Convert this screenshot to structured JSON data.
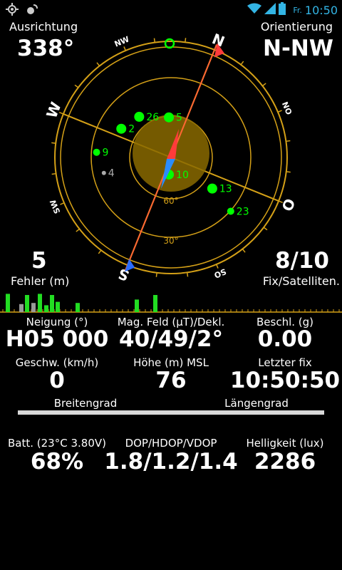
{
  "status_bar": {
    "icons_left": [
      "gps-icon",
      "settings-icon"
    ],
    "icons_right": [
      "wifi-icon",
      "signal-icon",
      "battery-icon"
    ],
    "day": "Fr.",
    "time": "10:50",
    "accent_color": "#33b5e5"
  },
  "compass": {
    "azimuth_label": "Ausrichtung",
    "azimuth_value": "338°",
    "orientation_label": "Orientierung",
    "orientation_value": "N-NW",
    "heading_deg": 338,
    "directions": {
      "N": "N",
      "NO": "NO",
      "O": "O",
      "SO": "SO",
      "S": "S",
      "SW": "SW",
      "W": "W",
      "NW": "NW"
    },
    "elevation_labels": [
      "60°",
      "30°"
    ],
    "ring_color": "#d4a017",
    "satellites": [
      {
        "id": "26",
        "azimuth": 300,
        "elevation": 45,
        "color": "#00ff00"
      },
      {
        "id": "5",
        "azimuth": 335,
        "elevation": 55,
        "color": "#00ff00"
      },
      {
        "id": "2",
        "azimuth": 278,
        "elevation": 40,
        "color": "#00ff00"
      },
      {
        "id": "9",
        "azimuth": 252,
        "elevation": 25,
        "color": "#00ff00"
      },
      {
        "id": "4",
        "azimuth": 235,
        "elevation": 30,
        "color": "#aaaaaa"
      },
      {
        "id": "10",
        "azimuth": 165,
        "elevation": 75,
        "color": "#00ff00"
      },
      {
        "id": "13",
        "azimuth": 105,
        "elevation": 45,
        "color": "#00ff00"
      },
      {
        "id": "23",
        "azimuth": 110,
        "elevation": 20,
        "color": "#00ff00"
      }
    ]
  },
  "left_stat": {
    "value": "5",
    "label": "Fehler (m)"
  },
  "right_stat": {
    "value": "8/10",
    "label": "Fix/Satelliten."
  },
  "signal_bars": [
    {
      "level": 0.8,
      "used": true
    },
    {
      "level": 0.35,
      "used": false
    },
    {
      "level": 0.75,
      "used": true
    },
    {
      "level": 0.4,
      "used": false
    },
    {
      "level": 0.8,
      "used": true
    },
    {
      "level": 0.3,
      "used": true
    },
    {
      "level": 0.75,
      "used": true
    },
    {
      "level": 0.45,
      "used": true
    },
    {
      "level": 0.4,
      "used": true
    },
    {
      "level": 0.55,
      "used": true
    },
    {
      "level": 0.75,
      "used": true
    }
  ],
  "grid": {
    "neigung": {
      "label": "Neigung (°)",
      "value": "H05 000"
    },
    "magfeld": {
      "label": "Mag. Feld (µT)/Dekl.",
      "value": "40/49/2°"
    },
    "beschl": {
      "label": "Beschl. (g)",
      "value": "0.00"
    },
    "geschw": {
      "label": "Geschw. (km/h)",
      "value": "0"
    },
    "hoehe": {
      "label": "Höhe (m) MSL",
      "value": "76"
    },
    "letzter": {
      "label": "Letzter fix",
      "value": "10:50:50"
    },
    "breiten": {
      "label": "Breitengrad"
    },
    "laengen": {
      "label": "Längengrad"
    },
    "batt": {
      "label": "Batt. (23°C 3.80V)",
      "value": "68%"
    },
    "dop": {
      "label": "DOP/HDOP/VDOP",
      "value": "1.8/1.2/1.4"
    },
    "hell": {
      "label": "Helligkeit (lux)",
      "value": "2286"
    }
  }
}
